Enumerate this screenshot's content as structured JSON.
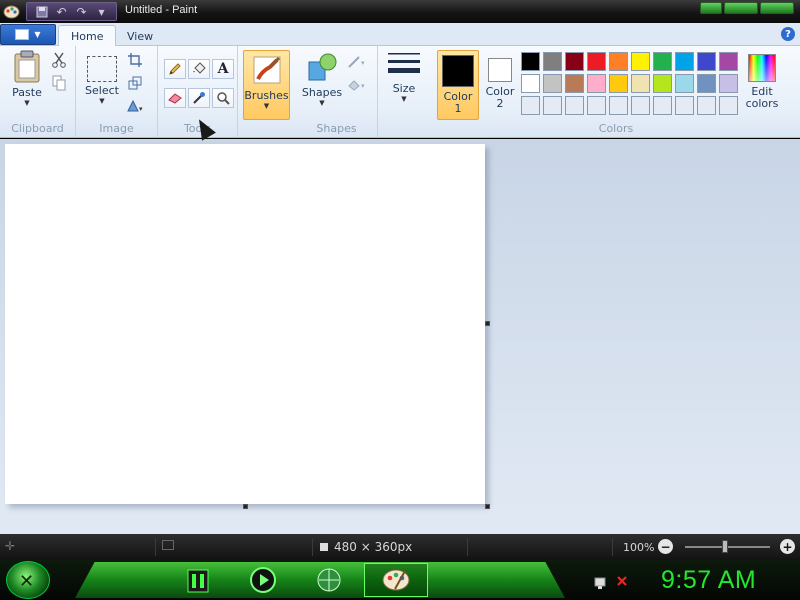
{
  "window": {
    "title": "Untitled - Paint",
    "app_icon": "paint-app-icon",
    "quick_access": [
      {
        "name": "save-icon",
        "glyph": "💾"
      },
      {
        "name": "undo-icon",
        "glyph": "↶"
      },
      {
        "name": "redo-icon",
        "glyph": "↷"
      },
      {
        "name": "customize-qat-icon",
        "glyph": "▾"
      }
    ]
  },
  "ribbon": {
    "tabs": [
      {
        "label": "Home",
        "active": true
      },
      {
        "label": "View",
        "active": false
      }
    ],
    "help_label": "?",
    "groups": {
      "clipboard": {
        "label": "Clipboard",
        "paste": "Paste"
      },
      "image": {
        "label": "Image",
        "select": "Select"
      },
      "tools": {
        "label": "Tools"
      },
      "brushes": {
        "label": "Brushes"
      },
      "shapes": {
        "label": "Shapes",
        "shapes_btn": "Shapes"
      },
      "size": {
        "label": "Size"
      },
      "colors": {
        "label": "Colors",
        "color1": "Color\n1",
        "color1_line1": "Color",
        "color1_line2": "1",
        "color2_line1": "Color",
        "color2_line2": "2",
        "edit_line1": "Edit",
        "edit_line2": "colors",
        "color1_value": "#000000",
        "color2_value": "#ffffff",
        "palette": [
          "#000000",
          "#7f7f7f",
          "#880015",
          "#ed1c24",
          "#ff7f27",
          "#fff200",
          "#22b14c",
          "#00a2e8",
          "#3f48cc",
          "#a349a4",
          "#ffffff",
          "#c3c3c3",
          "#b97a57",
          "#ffaec9",
          "#ffc90e",
          "#efe4b0",
          "#b5e61d",
          "#99d9ea",
          "#7092be",
          "#c8bfe7",
          "#e4ebf4",
          "#e4ebf4",
          "#e4ebf4",
          "#e4ebf4",
          "#e4ebf4",
          "#e4ebf4",
          "#e4ebf4",
          "#e4ebf4",
          "#e4ebf4",
          "#e4ebf4"
        ]
      }
    }
  },
  "statusbar": {
    "dimensions": "480 × 360px",
    "zoom": "100%",
    "zoom_out": "−",
    "zoom_in": "+"
  },
  "taskbar": {
    "clock": "9:57 AM"
  }
}
